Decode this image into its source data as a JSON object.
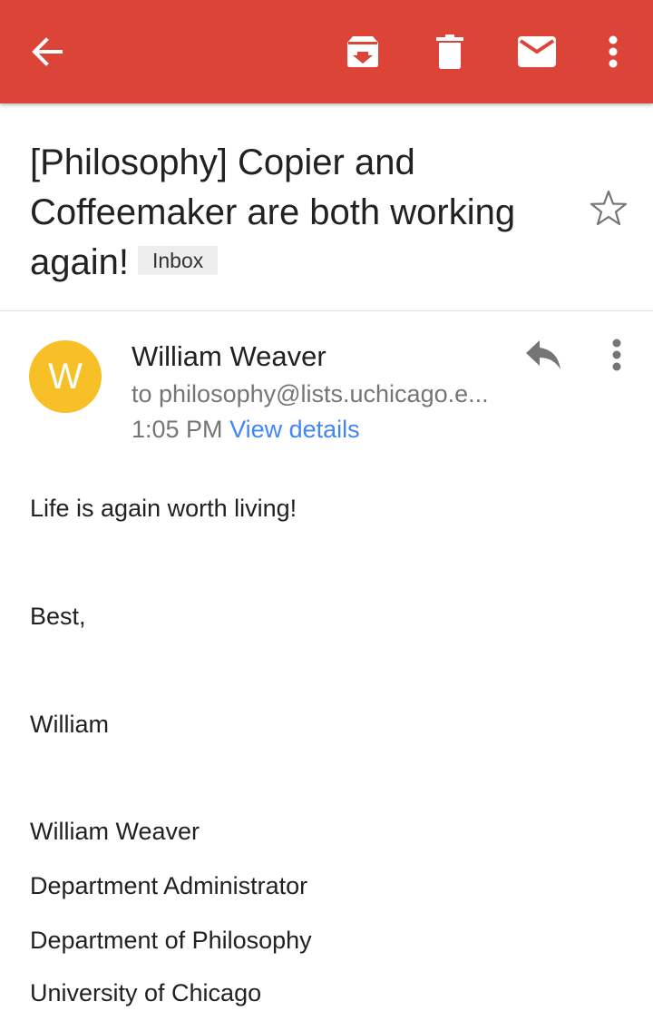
{
  "toolbar": {
    "background": "#db4437",
    "icons": [
      "back-arrow-icon",
      "archive-icon",
      "delete-icon",
      "mark-unread-icon",
      "more-vert-icon"
    ]
  },
  "email": {
    "subject": "[Philosophy] Copier and Coffeemaker are both working again!",
    "label": "Inbox",
    "sender": {
      "name": "William Weaver",
      "avatar_letter": "W",
      "avatar_color": "#f6c026"
    },
    "recipient": "to philosophy@lists.uchicago.e...",
    "time": "1:05 PM",
    "view_details": "View details",
    "body": {
      "line1": "Life is again worth living!",
      "line2": "Best,",
      "line3": "William",
      "sig_name": "William Weaver",
      "sig_title": "Department Administrator",
      "sig_dept": "Department of Philosophy",
      "sig_univ": "University of Chicago"
    }
  },
  "colors": {
    "link": "#4285f4",
    "secondary_text": "#757575"
  }
}
